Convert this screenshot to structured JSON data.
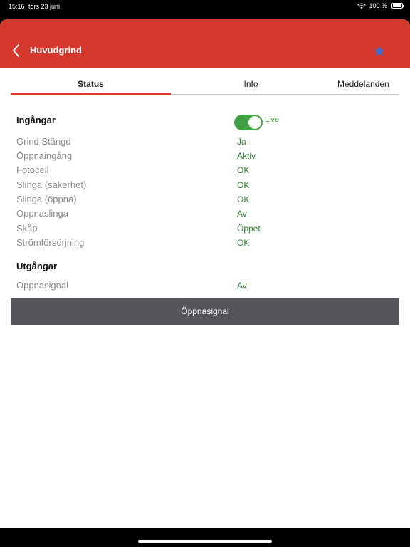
{
  "statusbar": {
    "time": "15:16",
    "date": "tors 23 juni",
    "battery_text": "100 %"
  },
  "header": {
    "title": "Huvudgrind",
    "background_color": "#d5392d",
    "back_icon": "chevron-left-icon",
    "favorite_icon": "star-icon",
    "favorite_color": "#2f6fe0"
  },
  "tabs": [
    {
      "label": "Status",
      "active": true
    },
    {
      "label": "Info",
      "active": false
    },
    {
      "label": "Meddelanden",
      "active": false
    }
  ],
  "inputs_section": {
    "title": "Ingångar",
    "live_label": "Live",
    "live_on": true,
    "rows": [
      {
        "label": "Grind Stängd",
        "value": "Ja"
      },
      {
        "label": "Öppnaingång",
        "value": "Aktiv"
      },
      {
        "label": "Fotocell",
        "value": "OK"
      },
      {
        "label": "Slinga (säkerhet)",
        "value": "OK"
      },
      {
        "label": "Slinga (öppna)",
        "value": "OK"
      },
      {
        "label": "Öppnaslinga",
        "value": "Av"
      },
      {
        "label": "Skåp",
        "value": "Öppet"
      },
      {
        "label": "Strömförsörjning",
        "value": "OK"
      }
    ]
  },
  "outputs_section": {
    "title": "Utgångar",
    "rows": [
      {
        "label": "Öppnasignal",
        "value": "Av"
      }
    ]
  },
  "action_button": {
    "label": "Öppnasignal"
  },
  "colors": {
    "accent": "#d5392d",
    "value_green": "#2e7d32",
    "toggle_green": "#43a047",
    "button_gray": "#545659"
  }
}
